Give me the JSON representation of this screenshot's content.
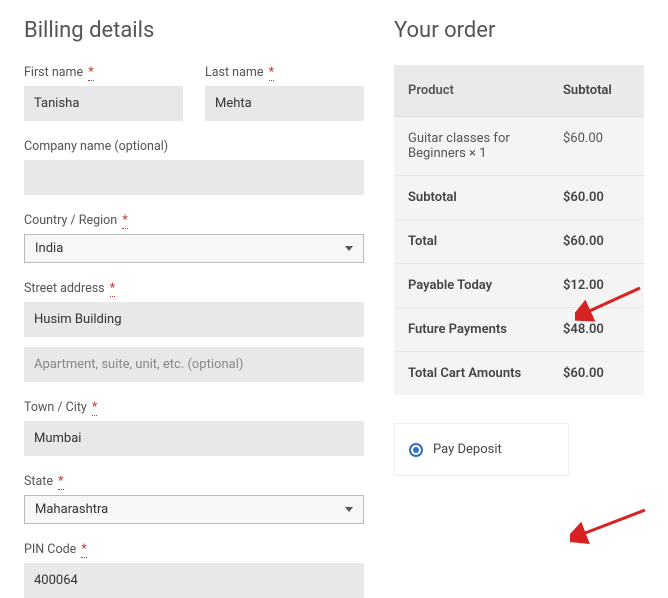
{
  "billing": {
    "title": "Billing details",
    "first_name_label": "First name",
    "first_name": "Tanisha",
    "last_name_label": "Last name",
    "last_name": "Mehta",
    "company_label": "Company name (optional)",
    "company": "",
    "country_label": "Country / Region",
    "country": "India",
    "street_label": "Street address",
    "street1": "Husim Building",
    "street2_placeholder": "Apartment, suite, unit, etc. (optional)",
    "city_label": "Town / City",
    "city": "Mumbai",
    "state_label": "State",
    "state": "Maharashtra",
    "pin_label": "PIN Code",
    "pin": "400064",
    "required": "*"
  },
  "order": {
    "title": "Your order",
    "head_product": "Product",
    "head_subtotal": "Subtotal",
    "item_name": "Guitar classes for Beginners  × 1",
    "item_price": "$60.00",
    "subtotal_label": "Subtotal",
    "subtotal": "$60.00",
    "total_label": "Total",
    "total": "$60.00",
    "payable_label": "Payable Today",
    "payable": "$12.00",
    "future_label": "Future Payments",
    "future": "$48.00",
    "cart_label": "Total Cart Amounts",
    "cart": "$60.00",
    "pay_deposit": "Pay Deposit"
  }
}
